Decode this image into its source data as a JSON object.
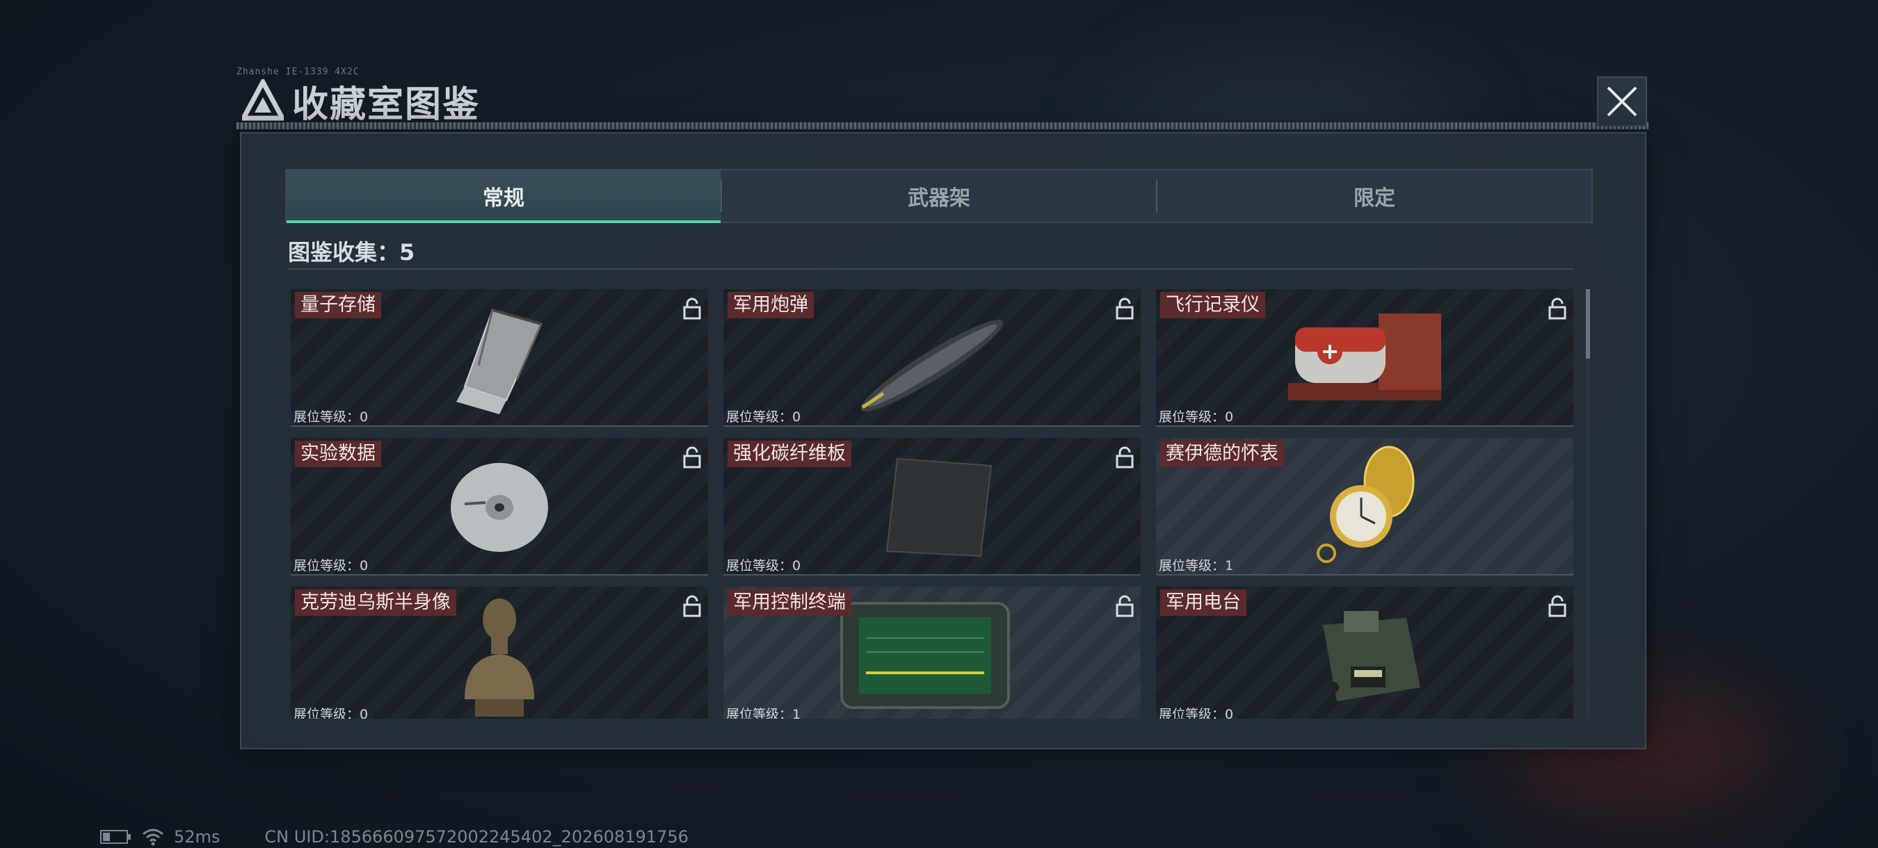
{
  "header": {
    "tiny_code": "Zhanshe IE-1339 4X2C",
    "title": "收藏室图鉴"
  },
  "tabs": [
    {
      "label": "常规",
      "active": true
    },
    {
      "label": "武器架",
      "active": false
    },
    {
      "label": "限定",
      "active": false
    }
  ],
  "collection": {
    "label": "图鉴收集：",
    "value": "5"
  },
  "items": [
    {
      "name": "量子存储",
      "level_label": "展位等级：",
      "level": "0",
      "owned": false,
      "icon": "usb-drive-icon"
    },
    {
      "name": "军用炮弹",
      "level_label": "展位等级：",
      "level": "0",
      "owned": false,
      "icon": "artillery-shell-icon"
    },
    {
      "name": "飞行记录仪",
      "level_label": "展位等级：",
      "level": "0",
      "owned": false,
      "icon": "flight-recorder-icon"
    },
    {
      "name": "实验数据",
      "level_label": "展位等级：",
      "level": "0",
      "owned": false,
      "icon": "disc-icon"
    },
    {
      "name": "强化碳纤维板",
      "level_label": "展位等级：",
      "level": "0",
      "owned": false,
      "icon": "carbon-plate-icon"
    },
    {
      "name": "赛伊德的怀表",
      "level_label": "展位等级：",
      "level": "1",
      "owned": true,
      "icon": "pocket-watch-icon"
    },
    {
      "name": "克劳迪乌斯半身像",
      "level_label": "展位等级：",
      "level": "0",
      "owned": false,
      "icon": "bust-statue-icon"
    },
    {
      "name": "军用控制终端",
      "level_label": "展位等级：",
      "level": "1",
      "owned": true,
      "icon": "control-terminal-icon"
    },
    {
      "name": "军用电台",
      "level_label": "展位等级：",
      "level": "0",
      "owned": false,
      "icon": "military-radio-icon"
    }
  ],
  "status_bar": {
    "ping": "52ms",
    "uid": "CN UID:18566609757200224540​2_202608191756"
  },
  "colors": {
    "accent": "#4fd49a",
    "name_tag": "#5a2a2c"
  }
}
